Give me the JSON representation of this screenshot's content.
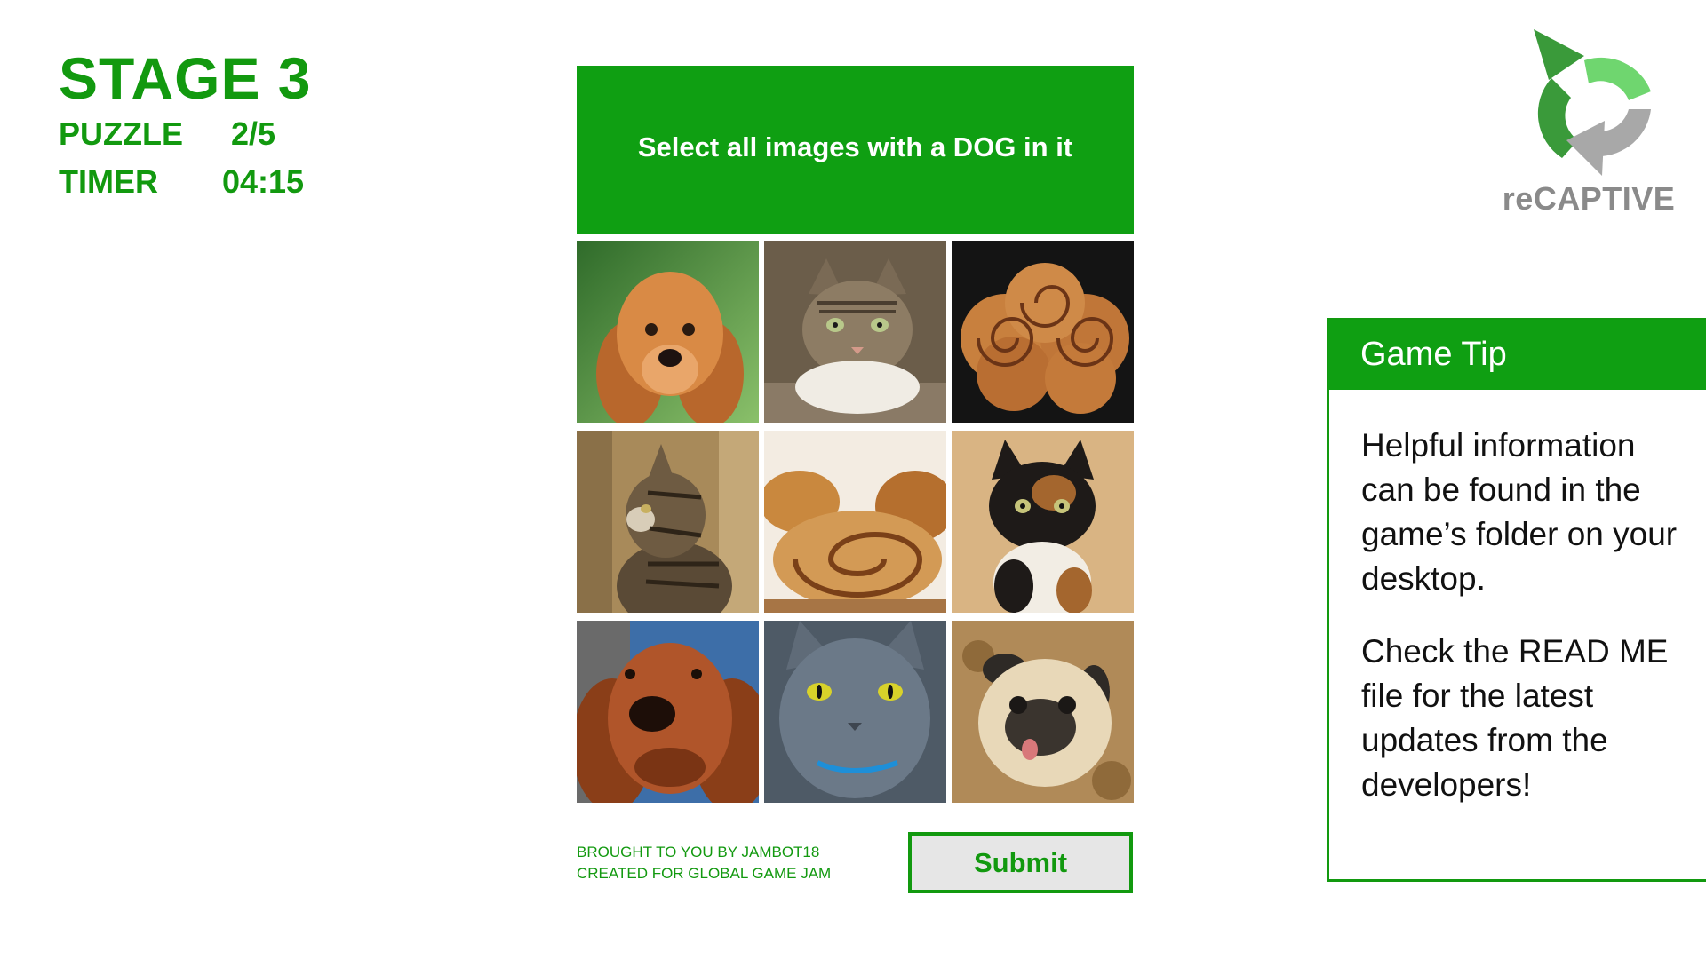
{
  "stage": {
    "title": "STAGE 3",
    "puzzle_label": "PUZZLE",
    "puzzle_value": "2/5",
    "timer_label": "TIMER",
    "timer_value": "04:15"
  },
  "captcha": {
    "instruction": "Select all images with a DOG in it",
    "tiles": [
      {
        "subject": "dog",
        "description": "cocker spaniel puppy"
      },
      {
        "subject": "cat",
        "description": "tabby cat lying down"
      },
      {
        "subject": "cinnamon-roll",
        "description": "cinnamon rolls on dark background"
      },
      {
        "subject": "cat",
        "description": "tabby cat profile"
      },
      {
        "subject": "cinnamon-roll",
        "description": "cinnamon roll close-up"
      },
      {
        "subject": "cat",
        "description": "calico cat"
      },
      {
        "subject": "dog",
        "description": "cocker spaniel close-up"
      },
      {
        "subject": "cat",
        "description": "grey cat with yellow eyes"
      },
      {
        "subject": "dog",
        "description": "pug"
      }
    ],
    "submit_label": "Submit"
  },
  "credits": {
    "line1": "BROUGHT TO YOU BY JAMBOT18",
    "line2": "CREATED FOR GLOBAL GAME JAM"
  },
  "logo": {
    "text": "reCAPTIVE",
    "icon": "recaptive-logo-icon"
  },
  "tip": {
    "title": "Game Tip",
    "paragraph1": "Helpful information can be found in the game’s folder on your desktop.",
    "paragraph2": "Check the READ ME file for the latest updates from the developers!"
  },
  "colors": {
    "brand_green": "#0f9f12",
    "text_green": "#12990f",
    "button_bg": "#e6e6e6",
    "logo_grey": "#8a8a8a",
    "logo_light_green": "#6fd66f",
    "logo_dark_green": "#3a9a3a"
  }
}
